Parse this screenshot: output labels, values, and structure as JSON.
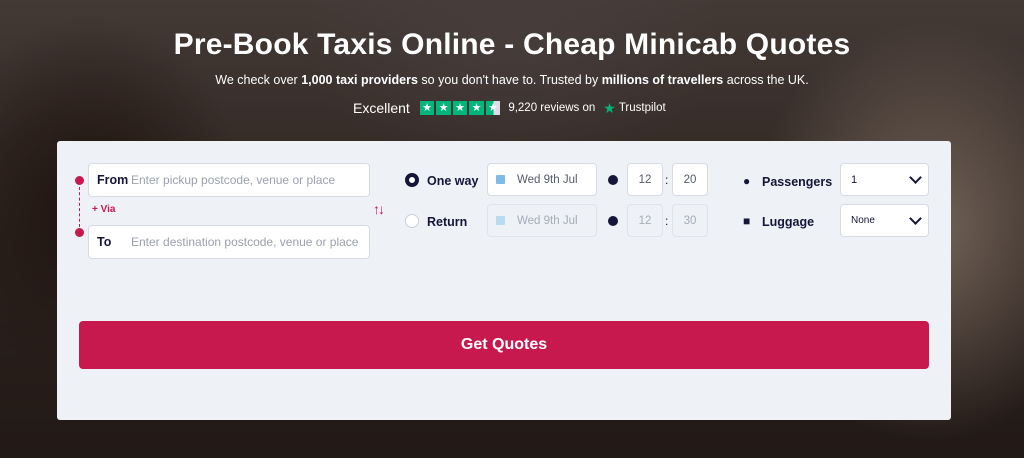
{
  "hero": {
    "title": "Pre-Book Taxis Online - Cheap Minicab Quotes",
    "subtitle_part1": "We check over ",
    "subtitle_bold1": "1,000 taxi providers",
    "subtitle_part2": " so you don't have to. Trusted by ",
    "subtitle_bold2": "millions of travellers",
    "subtitle_part3": " across the UK."
  },
  "trustpilot": {
    "rating_text": "Excellent",
    "stars": 4.5,
    "reviews": "9,220 reviews on",
    "brand": "Trustpilot"
  },
  "form": {
    "from_label": "From",
    "from_placeholder": "Enter pickup postcode, venue or place",
    "via_label": "+ Via",
    "to_label": "To",
    "to_placeholder": "Enter destination postcode, venue or place",
    "swap_icon": "swap-icon",
    "trip_options": [
      {
        "label": "One way",
        "selected": true
      },
      {
        "label": "Return",
        "selected": false
      }
    ],
    "outbound_date": "Wed 9th Jul",
    "outbound_hour": "12",
    "outbound_minute": "20",
    "return_date": "Wed 9th Jul",
    "return_hour": "12",
    "return_minute": "30",
    "time_separator": ":",
    "passengers_label": "Passengers",
    "passengers_value": "1",
    "luggage_label": "Luggage",
    "luggage_value": "None",
    "submit_label": "Get Quotes"
  },
  "colors": {
    "accent": "#c8194f",
    "navy": "#15153a",
    "trustpilot_green": "#00b67a",
    "card_bg": "#eef1f5"
  }
}
